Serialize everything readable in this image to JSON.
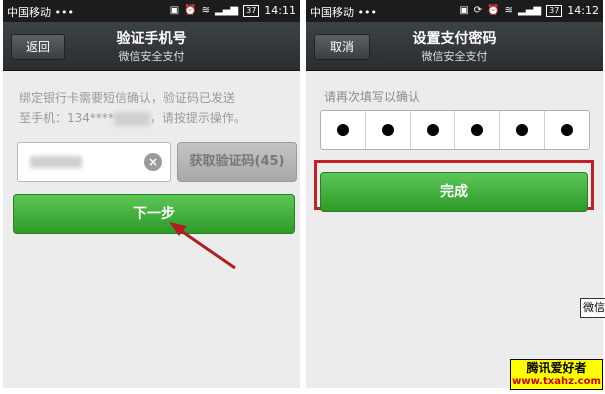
{
  "left_screen": {
    "status": {
      "carrier": "中国移动 •••",
      "battery": "37",
      "time": "14:11"
    },
    "title": "验证手机号",
    "subtitle": "微信安全支付",
    "back_label": "返回",
    "info_line1": "绑定银行卡需要短信确认，验证码已发送",
    "info_line2_prefix": "至手机：134****",
    "info_line2_suffix": "，请按提示操作。",
    "get_code_label": "获取验证码(45)",
    "next_label": "下一步"
  },
  "right_screen": {
    "status": {
      "carrier": "中国移动 •••",
      "battery": "37",
      "time": "14:12"
    },
    "title": "设置支付密码",
    "subtitle": "微信安全支付",
    "cancel_label": "取消",
    "prompt": "请再次填写以确认",
    "pin_digits": 6,
    "done_label": "完成"
  },
  "watermark": {
    "side_text": "微信",
    "name": "腾讯爱好者",
    "url": "www.txahz.com"
  },
  "colors": {
    "button_green": "#3cad36",
    "highlight_red": "#c0202a",
    "arrow": "#b02020"
  }
}
